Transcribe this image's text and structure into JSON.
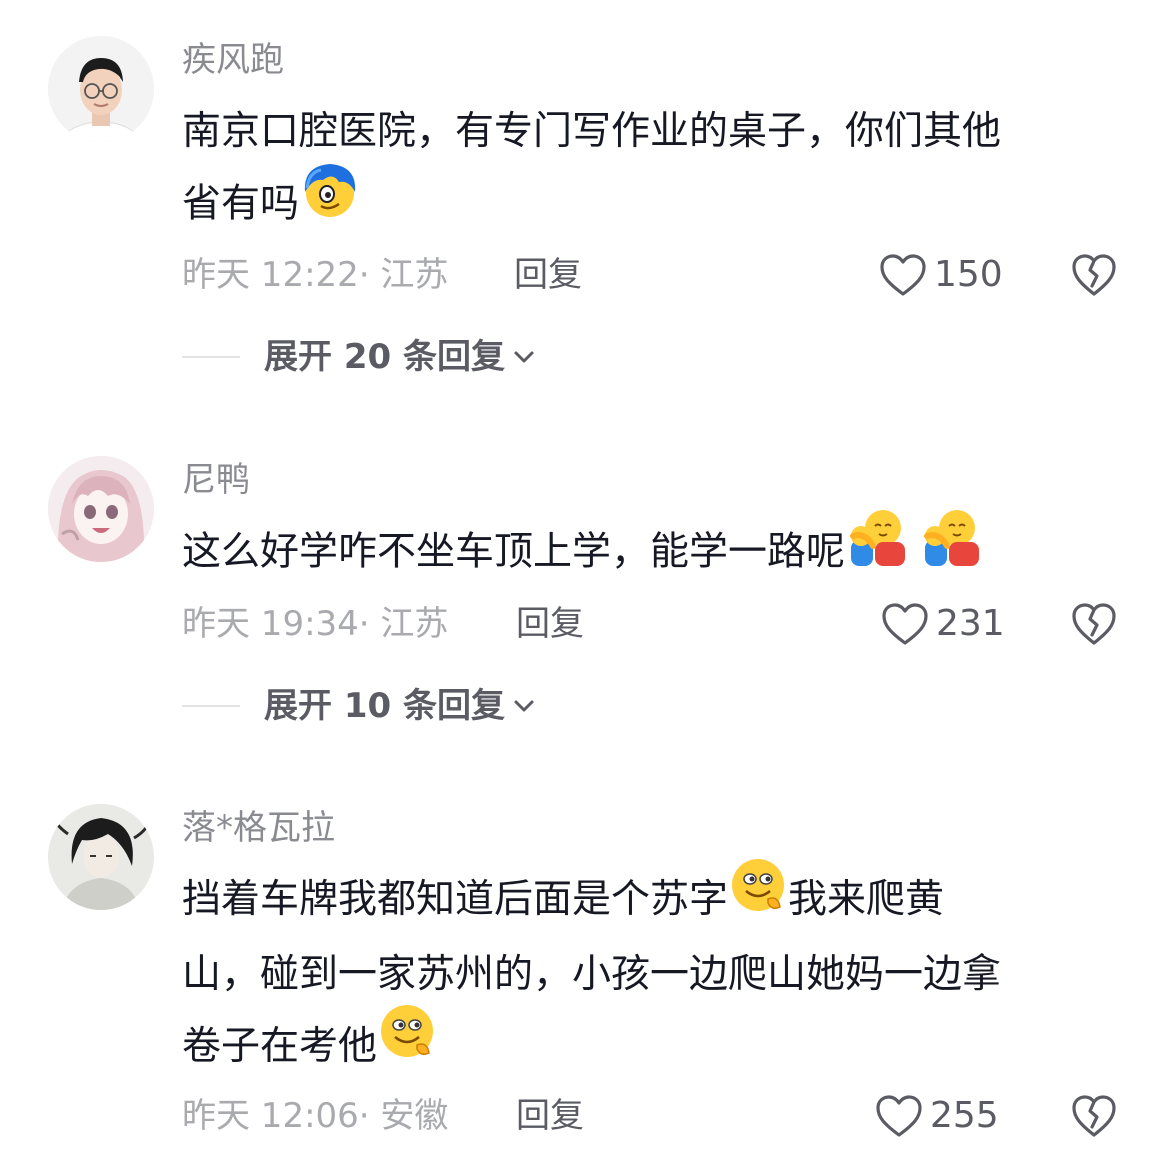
{
  "comments": [
    {
      "username": "疾风跑",
      "text_lines": [
        "南京口腔医院，有专门写作业的桌子，你们其他",
        "省有吗"
      ],
      "emoji_1": "blue-hair-peeking-emoji",
      "timestamp": "昨天 12:22",
      "location": "· 江苏",
      "reply_label": "回复",
      "likes": "150",
      "expand_label": "展开 20 条回复"
    },
    {
      "username": "尼鸭",
      "text_lines": [
        "这么好学咋不坐车顶上学，能学一路呢"
      ],
      "emoji_1": "hug-emoji",
      "emoji_2": "hug-emoji",
      "timestamp": "昨天 19:34",
      "location": "· 江苏",
      "reply_label": "回复",
      "likes": "231",
      "expand_label": "展开 10 条回复"
    },
    {
      "username": "落*格瓦拉",
      "text_lines": [
        "挡着车牌我都知道后面是个苏字",
        "我来爬黄",
        "山，碰到一家苏州的，小孩一边爬山她妈一边拿",
        "卷子在考他"
      ],
      "emoji_1": "cunning-smile-emoji",
      "emoji_2": "cunning-smile-emoji",
      "timestamp": "昨天 12:06",
      "location": "· 安徽",
      "reply_label": "回复",
      "likes": "255"
    }
  ],
  "colors": {
    "text_primary": "#161823",
    "text_secondary": "#8a8b91",
    "text_meta": "#a9aaae",
    "action": "#5a5b63"
  }
}
